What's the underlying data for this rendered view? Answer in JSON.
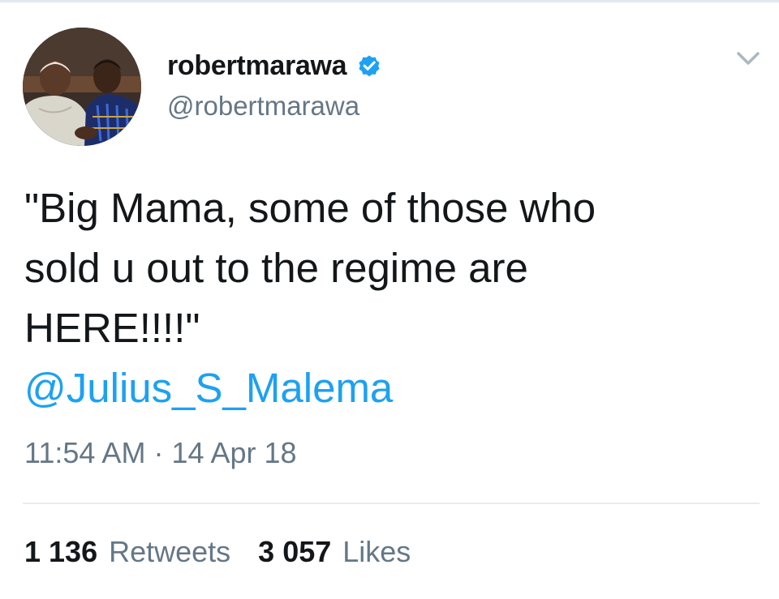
{
  "tweet": {
    "author": {
      "display_name": "robertmarawa",
      "handle": "@robertmarawa",
      "verified": true,
      "avatar_icon": "profile-photo"
    },
    "text_lines": [
      "\"Big Mama, some of those who",
      "sold u out to the regime are",
      "HERE!!!!\""
    ],
    "mention": "@Julius_S_Malema",
    "timestamp": {
      "time": "11:54 AM",
      "separator": "·",
      "date": "14 Apr 18"
    },
    "stats": {
      "retweets_count": "1 136",
      "retweets_label": "Retweets",
      "likes_count": "3 057",
      "likes_label": "Likes"
    },
    "menu_icon": "chevron-down-icon"
  },
  "colors": {
    "text": "#14171a",
    "secondary": "#657786",
    "link": "#1da1f2",
    "verified": "#1da1f2",
    "divider": "#e6ecf0"
  }
}
